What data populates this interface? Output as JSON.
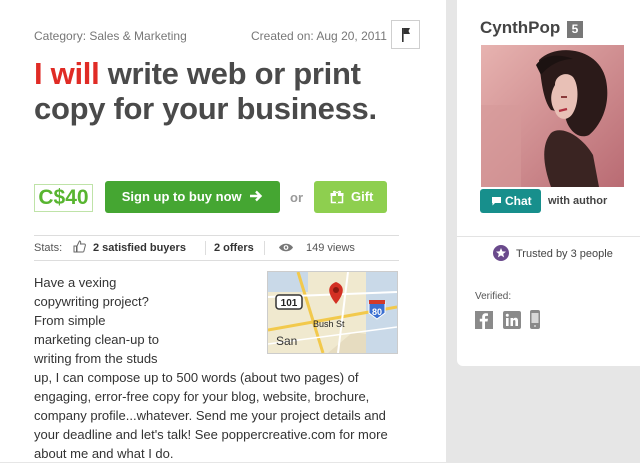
{
  "gig": {
    "category": "Category: Sales & Marketing",
    "created": "Created on: Aug 20, 2011",
    "title_highlight": "I will",
    "title_rest": " write web or print copy for your business.",
    "price": "C$40",
    "buy_label": "Sign up to buy now",
    "or_text": "or",
    "gift_label": "Gift",
    "stats": {
      "label": "Stats:",
      "buyers": "2 satisfied buyers",
      "offers": "2 offers",
      "views": "149 views"
    },
    "description": "Have a vexing copywriting project? From simple marketing clean-up to writing from the studs up, I can compose up to 500 words (about two pages) of engaging, error-free copy for your blog, website, brochure, company profile...whatever. Send me your project details and your deadline and let's talk! See poppercreative.com for more about me and what I do.",
    "map": {
      "route_101": "101",
      "route_80": "80",
      "street": "Bush St",
      "city": "San"
    }
  },
  "seller": {
    "name": "CynthPop",
    "level": "5",
    "chat_label": "Chat",
    "with_author": "with author",
    "trusted": "Trusted by 3 people",
    "verified_label": "Verified:"
  },
  "icons": {
    "flag": "flag-icon",
    "thumbs_up": "thumbs-up-icon",
    "eye": "eye-icon",
    "arrow": "arrow-right-icon",
    "gift": "gift-icon",
    "chat": "chat-bubble-icon",
    "star": "star-icon",
    "facebook": "facebook-icon",
    "linkedin": "linkedin-icon",
    "phone": "phone-icon"
  },
  "colors": {
    "title_highlight": "#e02b25",
    "price": "#58b530",
    "buy_button": "#45a632",
    "gift_button": "#8ecf4f",
    "chat_button": "#178f8c",
    "trust_badge": "#6a4a8c"
  }
}
